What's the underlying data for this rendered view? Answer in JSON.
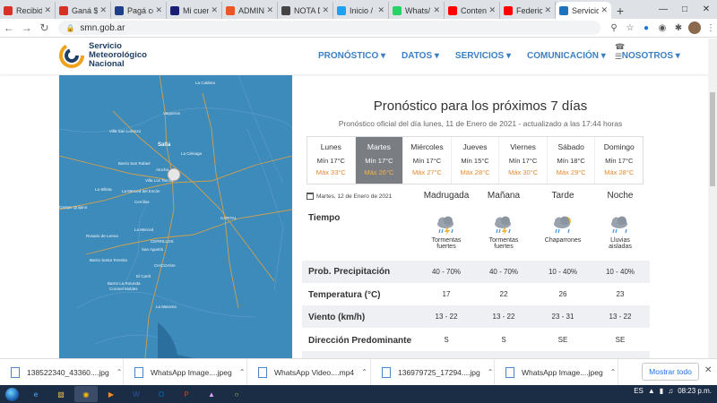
{
  "browser": {
    "tabs": [
      {
        "label": "Recibid",
        "icon": "gmail-icon",
        "color": "#d93025"
      },
      {
        "label": "Ganá $",
        "icon": "gmail-icon",
        "color": "#d93025"
      },
      {
        "label": "Pagá co",
        "icon": "mercadopago-icon",
        "color": "#1f3f8a"
      },
      {
        "label": "Mi cuen",
        "icon": "visa-icon",
        "color": "#1a1f71"
      },
      {
        "label": "ADMIN",
        "icon": "admin-icon",
        "color": "#e8562a"
      },
      {
        "label": "NOTA D",
        "icon": "nota-icon",
        "color": "#444444"
      },
      {
        "label": "Inicio /",
        "icon": "twitter-icon",
        "color": "#1da1f2"
      },
      {
        "label": "Whats/",
        "icon": "whatsapp-icon",
        "color": "#25d366"
      },
      {
        "label": "Conten",
        "icon": "youtube-icon",
        "color": "#ff0000"
      },
      {
        "label": "Federic",
        "icon": "youtube-icon",
        "color": "#ff0000"
      },
      {
        "label": "Servicio",
        "icon": "smn-icon",
        "color": "#1e73be",
        "active": true
      }
    ],
    "url": "smn.gob.ar"
  },
  "site": {
    "logo_lines": [
      "Servicio",
      "Meteorológico",
      "Nacional"
    ],
    "nav": [
      "PRONÓSTICO ▾",
      "DATOS ▾",
      "SERVICIOS ▾",
      "COMUNICACIÓN ▾",
      "NOSOTROS ▾"
    ]
  },
  "map": {
    "places": [
      "La Caldera",
      "Vaqueros",
      "Villa San Lorenzo",
      "Salta",
      "La Ciénaga",
      "Barrio San Rafael",
      "Atocha",
      "Villa Los Tarcos",
      "La Silleta",
      "La Merced del Encón",
      "Campo Quijano",
      "Cerrillos",
      "La Merced",
      "Rosario de Lerma",
      "Barrio Santa Teresita",
      "San Agustín",
      "El Carril",
      "Barrio La Rotonda",
      "Coronel Moldes",
      "La Maroma",
      "CAPITAL",
      "CERRILLOS",
      "CHICOANA"
    ]
  },
  "forecast": {
    "title": "Pronóstico para los próximos 7 días",
    "subtitle": "Pronóstico oficial del día lunes, 11 de Enero de 2021 - actualizado a las 17:44 horas",
    "days": [
      {
        "name": "Lunes",
        "min": "Mín 17°C",
        "max": "Máx 33°C"
      },
      {
        "name": "Martes",
        "min": "Mín 17°C",
        "max": "Máx 26°C",
        "selected": true
      },
      {
        "name": "Miércoles",
        "min": "Mín 17°C",
        "max": "Máx 27°C"
      },
      {
        "name": "Jueves",
        "min": "Mín 15°C",
        "max": "Máx 28°C"
      },
      {
        "name": "Viernes",
        "min": "Mín 17°C",
        "max": "Máx 30°C"
      },
      {
        "name": "Sábado",
        "min": "Mín 18°C",
        "max": "Máx 29°C"
      },
      {
        "name": "Domingo",
        "min": "Mín 17°C",
        "max": "Máx 28°C"
      }
    ],
    "detail_date": "Martes, 12 de Enero de 2021",
    "periods": [
      "Madrugada",
      "Mañana",
      "Tarde",
      "Noche"
    ],
    "rows": {
      "tiempo": "Tiempo",
      "precip": "Prob. Precipitación",
      "temp": "Temperatura (°C)",
      "viento": "Viento (km/h)",
      "direccion": "Dirección Predominante"
    },
    "weather": [
      {
        "line1": "Tormentas",
        "line2": "fuertes",
        "icon": "storm-icon"
      },
      {
        "line1": "Tormentas",
        "line2": "fuertes",
        "icon": "storm-icon"
      },
      {
        "line1": "Chaparrones",
        "line2": "",
        "icon": "showers-icon"
      },
      {
        "line1": "Lluvias",
        "line2": "aisladas",
        "icon": "rain-icon"
      }
    ],
    "precip": [
      "40 - 70%",
      "40 - 70%",
      "10 - 40%",
      "10 - 40%"
    ],
    "temp": [
      "17",
      "22",
      "26",
      "23"
    ],
    "wind": [
      "13 - 22",
      "13 - 22",
      "23 - 31",
      "13 - 22"
    ],
    "dir": [
      "S",
      "S",
      "SE",
      "SE"
    ]
  },
  "downloads": {
    "items": [
      "138522340_43360....jpg",
      "WhatsApp Image....jpeg",
      "WhatsApp Video....mp4",
      "136979725_17294....jpg",
      "WhatsApp Image....jpeg"
    ],
    "show_all": "Mostrar todo"
  },
  "taskbar": {
    "lang": "ES",
    "time": "08:23 p.m."
  },
  "colors": {
    "accent": "#3b7fc4",
    "map": "#3d8bbb",
    "max_temp": "#e8882d"
  }
}
